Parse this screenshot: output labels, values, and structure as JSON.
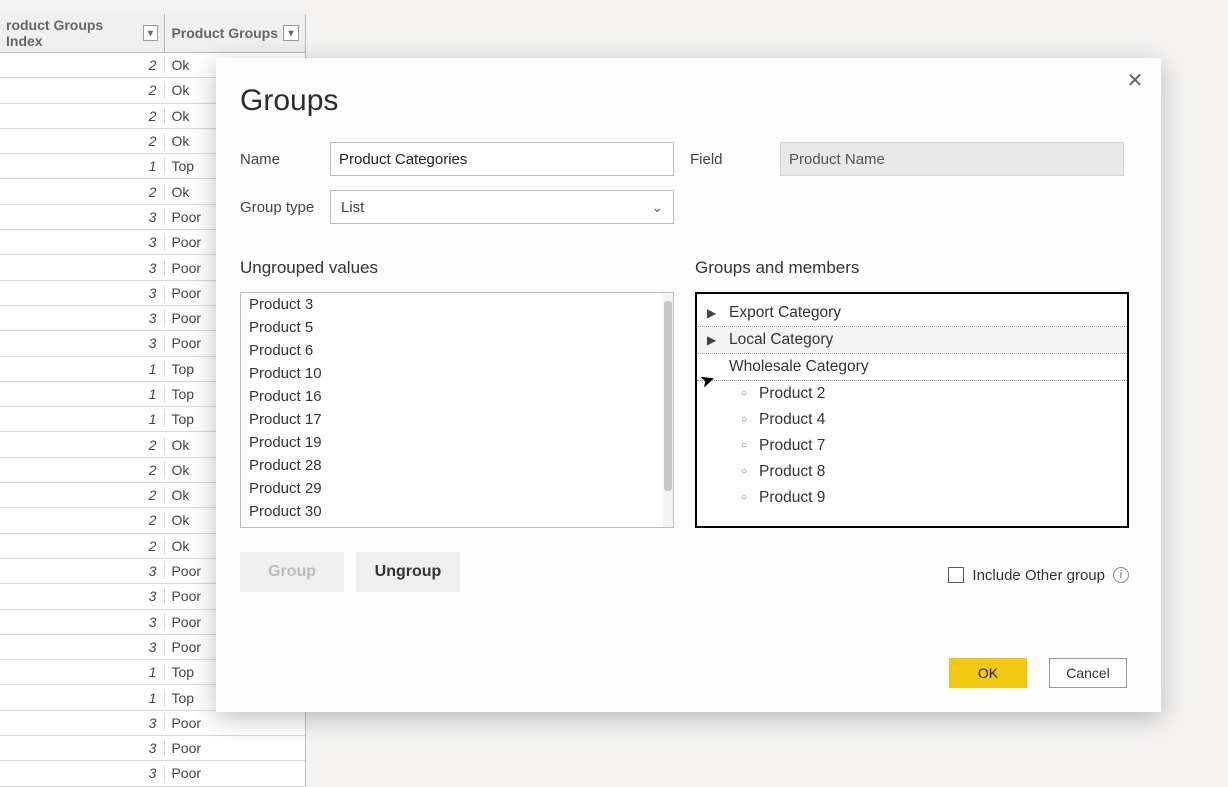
{
  "background_table": {
    "columns": [
      "roduct Groups Index",
      "Product Groups"
    ],
    "rows": [
      {
        "index": "2",
        "group": "Ok"
      },
      {
        "index": "2",
        "group": "Ok"
      },
      {
        "index": "2",
        "group": "Ok"
      },
      {
        "index": "2",
        "group": "Ok"
      },
      {
        "index": "1",
        "group": "Top"
      },
      {
        "index": "2",
        "group": "Ok"
      },
      {
        "index": "3",
        "group": "Poor"
      },
      {
        "index": "3",
        "group": "Poor"
      },
      {
        "index": "3",
        "group": "Poor"
      },
      {
        "index": "3",
        "group": "Poor"
      },
      {
        "index": "3",
        "group": "Poor"
      },
      {
        "index": "3",
        "group": "Poor"
      },
      {
        "index": "1",
        "group": "Top"
      },
      {
        "index": "1",
        "group": "Top"
      },
      {
        "index": "1",
        "group": "Top"
      },
      {
        "index": "2",
        "group": "Ok"
      },
      {
        "index": "2",
        "group": "Ok"
      },
      {
        "index": "2",
        "group": "Ok"
      },
      {
        "index": "2",
        "group": "Ok"
      },
      {
        "index": "2",
        "group": "Ok"
      },
      {
        "index": "3",
        "group": "Poor"
      },
      {
        "index": "3",
        "group": "Poor"
      },
      {
        "index": "3",
        "group": "Poor"
      },
      {
        "index": "3",
        "group": "Poor"
      },
      {
        "index": "1",
        "group": "Top"
      },
      {
        "index": "1",
        "group": "Top"
      },
      {
        "index": "3",
        "group": "Poor"
      },
      {
        "index": "3",
        "group": "Poor"
      },
      {
        "index": "3",
        "group": "Poor"
      }
    ]
  },
  "dialog": {
    "title": "Groups",
    "name_label": "Name",
    "name_value": "Product Categories",
    "field_label": "Field",
    "field_value": "Product Name",
    "grouptype_label": "Group type",
    "grouptype_value": "List",
    "ungrouped_header": "Ungrouped values",
    "ungrouped_values": [
      "Product 3",
      "Product 5",
      "Product 6",
      "Product 10",
      "Product 16",
      "Product 17",
      "Product 19",
      "Product 28",
      "Product 29",
      "Product 30"
    ],
    "groups_header": "Groups and members",
    "groups": [
      {
        "name": "Export Category",
        "expanded": false,
        "members": []
      },
      {
        "name": "Local Category",
        "expanded": false,
        "members": []
      },
      {
        "name": "Wholesale Category",
        "expanded": true,
        "members": [
          "Product 2",
          "Product 4",
          "Product 7",
          "Product 8",
          "Product 9"
        ]
      }
    ],
    "group_button": "Group",
    "ungroup_button": "Ungroup",
    "include_other_label": "Include Other group",
    "ok_label": "OK",
    "cancel_label": "Cancel"
  }
}
